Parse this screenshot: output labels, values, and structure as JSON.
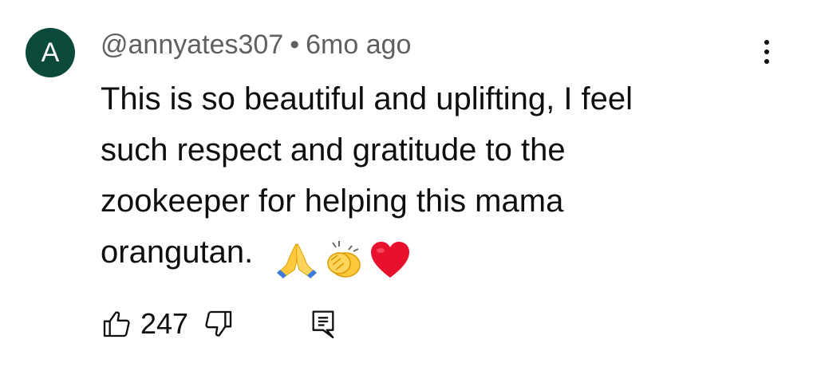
{
  "comment": {
    "avatar_letter": "A",
    "author": "@annyates307",
    "separator": "•",
    "timestamp": "6mo ago",
    "text_lines": [
      "This is so beautiful and uplifting, I feel",
      "such respect and gratitude to the",
      "zookeeper for helping this mama",
      "orangutan."
    ],
    "emojis": [
      "folded-hands",
      "clapping-hands",
      "red-heart"
    ],
    "like_count": "247",
    "colors": {
      "avatar_bg": "#0b4a3a",
      "meta_text": "#606060",
      "body_text": "#0f0f0f",
      "heart": "#e8112d",
      "clap": "#ffc83d"
    }
  }
}
